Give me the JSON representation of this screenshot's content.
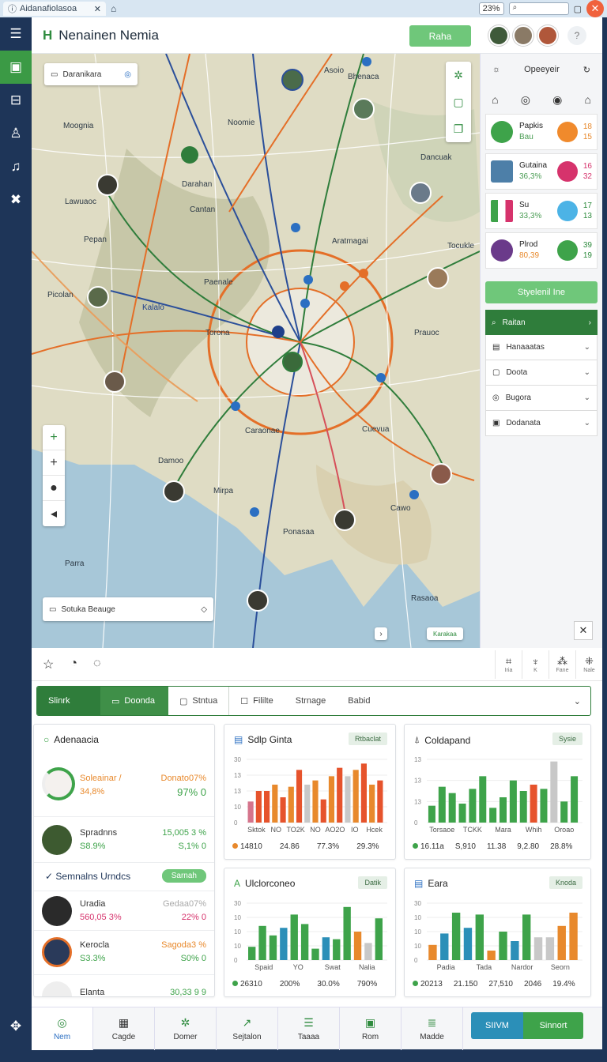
{
  "browser": {
    "tab_title": "Aidanafiolasoa",
    "zoom": "23%"
  },
  "header": {
    "title": "Nenainen Nemia",
    "action_label": "Raha",
    "help": "?"
  },
  "map": {
    "search_box": "Daranikara",
    "bottom_search": "Sotuka Beauge",
    "credit": "Karakaa",
    "labels": [
      {
        "t": "Asoio"
      },
      {
        "t": "Noomie"
      },
      {
        "t": "Moognia"
      },
      {
        "t": "Darahan"
      },
      {
        "t": "Cantan"
      },
      {
        "t": "Lawuaoc"
      },
      {
        "t": "Pepan"
      },
      {
        "t": "Aratmagai"
      },
      {
        "t": "Paenale"
      },
      {
        "t": "Picolan"
      },
      {
        "t": "Kalalo"
      },
      {
        "t": "Torona"
      },
      {
        "t": "Prauoc"
      },
      {
        "t": "Damoo"
      },
      {
        "t": "Cuevua"
      },
      {
        "t": "Tocukle"
      },
      {
        "t": "Dancuak"
      },
      {
        "t": "Mirpa"
      },
      {
        "t": "Parra"
      },
      {
        "t": "Rasaoa"
      },
      {
        "t": "Cawo"
      },
      {
        "t": "Ponasaa"
      },
      {
        "t": "Caraonae"
      },
      {
        "t": "Bhenaca"
      }
    ]
  },
  "sidebar": {
    "header": "Opeeyeir",
    "cards": [
      {
        "name": "Papkis",
        "sub": "Bau",
        "n1": "18",
        "n2": "15",
        "color": "#f08a2c"
      },
      {
        "name": "Gutaina",
        "sub": "36,3%",
        "n1": "16",
        "n2": "32",
        "color": "#d6336c"
      },
      {
        "name": "Su",
        "sub": "33,3%",
        "n1": "17",
        "n2": "13",
        "color": "#4cb3e6"
      },
      {
        "name": "Plrod",
        "sub": "80,39",
        "n1": "39",
        "n2": "19",
        "color": "#3ea34a"
      }
    ],
    "button": "Styelenil Ine",
    "filters": [
      "Raitan",
      "Hanaaatas",
      "Doota",
      "Bugora",
      "Dodanata"
    ]
  },
  "bottombar": {
    "right_tools": [
      "Iria",
      "K",
      "Fane",
      "Nale"
    ]
  },
  "tabs": {
    "items": [
      "Slinrk",
      "Doonda",
      "Stntua",
      "Fililte",
      "Strnage",
      "Babid"
    ]
  },
  "panel_left": {
    "title": "Adenaacia",
    "rows": [
      {
        "a1": "Soleainar /",
        "a2": "34,8%",
        "b1": "Donato07%",
        "b2": "97% 0",
        "c1": "#e8892c",
        "c2": "#3ea34a"
      },
      {
        "a1": "Spradnns",
        "a2": "S8.9%",
        "b1": "15,005 3 %",
        "b2": "S,1% 0",
        "c1": "#222",
        "c2": "#3ea34a"
      }
    ],
    "section": "Semnalns Urndcs",
    "section_btn": "Sarnah",
    "rows2": [
      {
        "a1": "Uradia",
        "a2": "560,05 3%",
        "b1": "Gedaa07%",
        "b2": "22% 0",
        "c2": "#d6336c"
      },
      {
        "a1": "Kerocla",
        "a2": "S3.3%",
        "b1": "Sagoda3 %",
        "b2": "S0% 0",
        "c2": "#3ea34a"
      },
      {
        "a1": "Elanta",
        "a2": "",
        "b1": "30,33 9 9",
        "b2": ""
      }
    ]
  },
  "charts": [
    {
      "title": "Sdlp Ginta",
      "tag": "Rtbaclat",
      "icon": "bars-icon",
      "chart_data": {
        "type": "bar",
        "categories": [
          "Sktok",
          "NO",
          "TO2K",
          "NO",
          "AO2O",
          "IO",
          "Hcek"
        ],
        "ylim": [
          0,
          30
        ],
        "ticks": [
          "30",
          "13",
          "13",
          "10",
          "0"
        ],
        "series": [
          {
            "color": "#d5748c",
            "values": [
              10,
              15,
              15,
              18,
              12,
              17,
              25,
              18,
              20,
              11,
              22,
              26,
              22,
              25,
              28,
              18,
              20
            ]
          }
        ]
      },
      "legend": [
        {
          "t": "14810",
          "c": "#e8892c"
        },
        {
          "t": "24.86",
          "c": ""
        },
        {
          "t": "77.3%",
          "c": ""
        },
        {
          "t": "29.3%",
          "c": ""
        }
      ]
    },
    {
      "title": "Coldapand",
      "tag": "Sysie",
      "icon": "leaf-icon",
      "chart_data": {
        "type": "bar",
        "categories": [
          "Torsaoe",
          "TCKK",
          "Mara",
          "Whih",
          "Oroao"
        ],
        "ylim": [
          0,
          30
        ],
        "ticks": [
          "13",
          "13",
          "13",
          "0"
        ],
        "series": [
          {
            "color": "#3ea34a",
            "values": [
              8,
              17,
              14,
              9,
              16,
              22,
              7,
              12,
              20,
              15,
              18,
              16,
              29,
              10,
              22
            ]
          }
        ]
      },
      "legend": [
        {
          "t": "16.11a",
          "c": "#3ea34a"
        },
        {
          "t": "S,910",
          "c": ""
        },
        {
          "t": "11.38",
          "c": ""
        },
        {
          "t": "9,2.80",
          "c": ""
        },
        {
          "t": "28.8%",
          "c": ""
        }
      ]
    },
    {
      "title": "Ulclorconeo",
      "tag": "Datik",
      "icon": "area-icon",
      "chart_data": {
        "type": "bar",
        "categories": [
          "Spaid",
          "YO",
          "Swat",
          "Nalia"
        ],
        "ylim": [
          0,
          30
        ],
        "ticks": [
          "30",
          "10",
          "10",
          "10",
          "0"
        ],
        "series": [
          {
            "color": "#3ea34a",
            "values": [
              7,
              18,
              13,
              17,
              24,
              19,
              6,
              12,
              11,
              28,
              15,
              9,
              22
            ]
          }
        ]
      },
      "legend": [
        {
          "t": "26310",
          "c": "#3ea34a"
        },
        {
          "t": "200%",
          "c": ""
        },
        {
          "t": "30.0%",
          "c": ""
        },
        {
          "t": "790%",
          "c": ""
        }
      ]
    },
    {
      "title": "Eara",
      "tag": "Knoda",
      "icon": "bars-icon",
      "chart_data": {
        "type": "bar",
        "categories": [
          "Padia",
          "Tada",
          "Nardor",
          "Seorn"
        ],
        "ylim": [
          0,
          30
        ],
        "ticks": [
          "30",
          "10",
          "10",
          "10",
          "0"
        ],
        "series": [
          {
            "color": "#3ea34a",
            "values": [
              8,
              14,
              25,
              17,
              24,
              5,
              15,
              10,
              24,
              12,
              12,
              18,
              25
            ]
          }
        ]
      },
      "legend": [
        {
          "t": "20213",
          "c": "#3ea34a"
        },
        {
          "t": "21.150",
          "c": ""
        },
        {
          "t": "27,510",
          "c": ""
        },
        {
          "t": "2046",
          "c": ""
        },
        {
          "t": "19.4%",
          "c": ""
        }
      ]
    }
  ],
  "bottom_nav": {
    "items": [
      "Nem",
      "Cagde",
      "Domer",
      "Sejtalon",
      "Taaaa",
      "Rom",
      "Madde"
    ],
    "combo_left": "SIIVM",
    "combo_right": "Sinnort"
  }
}
